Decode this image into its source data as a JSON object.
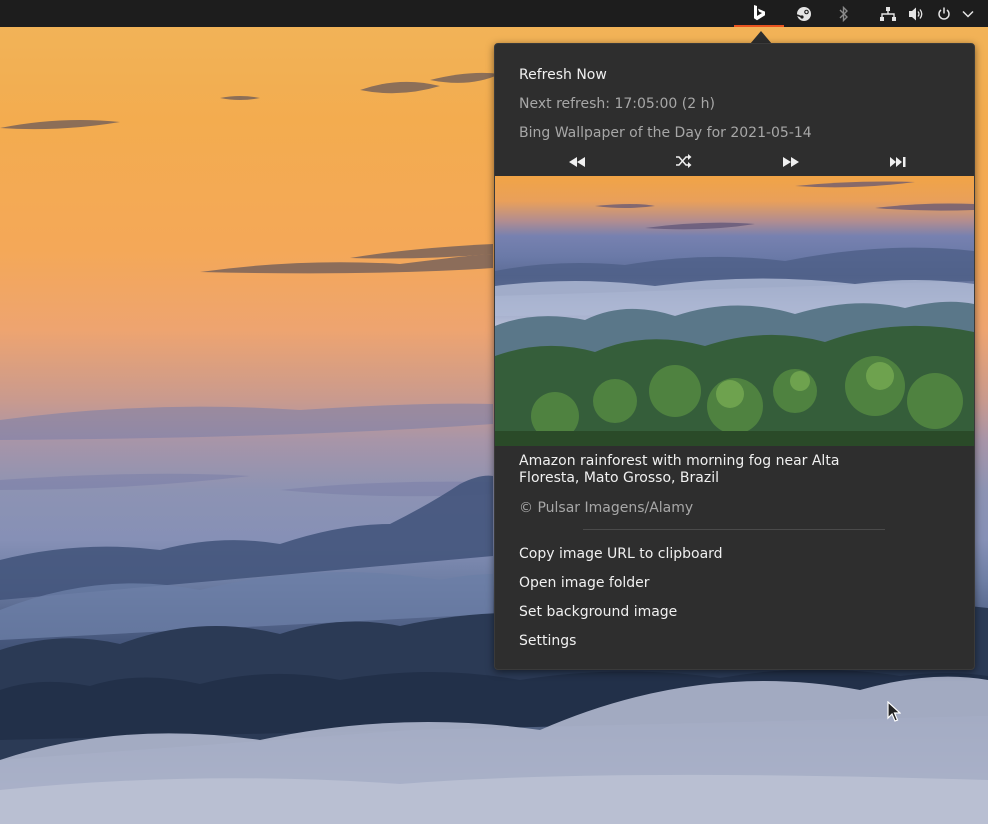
{
  "top_panel": {
    "tray_icons": [
      "bing-icon",
      "steam-icon",
      "bluetooth-icon",
      "network-icon",
      "volume-icon",
      "power-icon",
      "chevron-down-icon"
    ]
  },
  "menu": {
    "refresh_now": "Refresh Now",
    "next_refresh": "Next refresh: 17:05:00 (2 h)",
    "wallpaper_title": "Bing Wallpaper of the Day for 2021-05-14",
    "controls": [
      "previous-icon",
      "random-icon",
      "next-icon",
      "last-icon"
    ],
    "caption": "Amazon rainforest with morning fog near Alta Floresta, Mato Grosso, Brazil",
    "copyright": "© Pulsar Imagens/Alamy",
    "copy_url": "Copy image URL to clipboard",
    "open_folder": "Open image folder",
    "set_background": "Set background image",
    "settings": "Settings"
  },
  "colors": {
    "panel_bg": "#1d1d1d",
    "menu_bg": "#2e2e2e",
    "accent": "#e95420",
    "dim_text": "#a7a7a7"
  }
}
